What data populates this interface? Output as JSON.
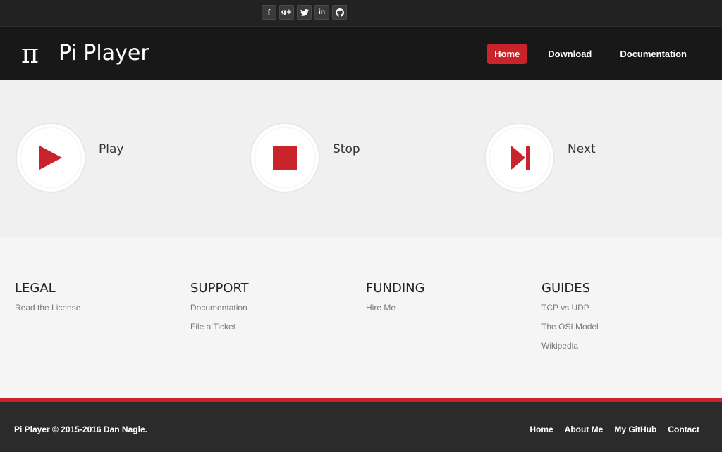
{
  "social": {
    "facebook_glyph": "f",
    "googleplus_glyph": "g+",
    "twitter_glyph": "t",
    "linkedin_glyph": "in",
    "github_glyph": "gh"
  },
  "header": {
    "logo_symbol": "π",
    "logo_text": "Pi Player",
    "nav": [
      {
        "label": "Home",
        "active": true
      },
      {
        "label": "Download",
        "active": false
      },
      {
        "label": "Documentation",
        "active": false
      }
    ]
  },
  "features": [
    {
      "title": "Play",
      "icon": "play-icon"
    },
    {
      "title": "Stop",
      "icon": "stop-icon"
    },
    {
      "title": "Next",
      "icon": "next-icon"
    }
  ],
  "links": {
    "legal": {
      "heading": "LEGAL",
      "items": [
        "Read the License"
      ]
    },
    "support": {
      "heading": "SUPPORT",
      "items": [
        "Documentation",
        "File a Ticket"
      ]
    },
    "funding": {
      "heading": "FUNDING",
      "items": [
        "Hire Me"
      ]
    },
    "guides": {
      "heading": "GUIDES",
      "items": [
        "TCP vs UDP",
        "The OSI Model",
        "Wikipedia"
      ]
    }
  },
  "footer": {
    "copyright": "Pi Player © 2015-2016 Dan Nagle.",
    "nav": [
      "Home",
      "About Me",
      "My GitHub",
      "Contact"
    ]
  },
  "colors": {
    "accent": "#c9232b",
    "header_bg": "#181818",
    "topbar_bg": "#222222",
    "footer_bg": "#2b2b2b"
  }
}
